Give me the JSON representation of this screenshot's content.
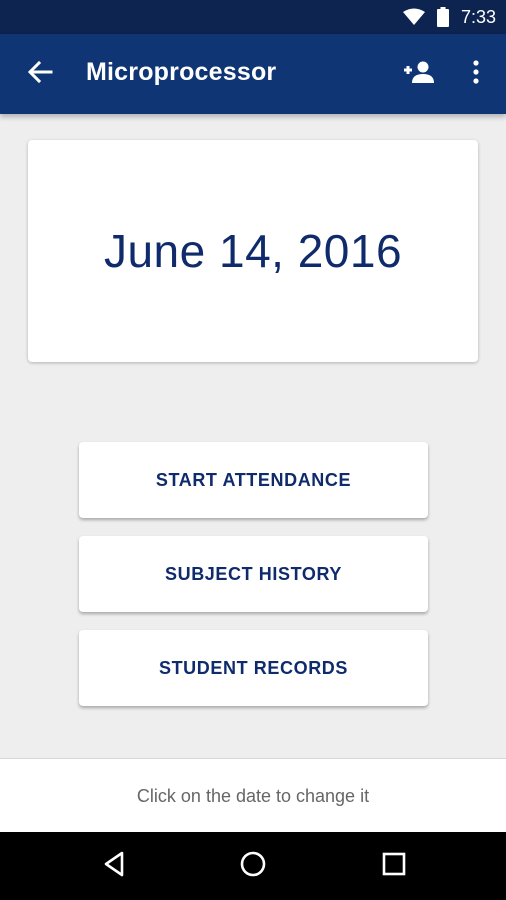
{
  "status_bar": {
    "time": "7:33",
    "icons": [
      "wifi-icon",
      "battery-icon"
    ]
  },
  "app_bar": {
    "title": "Microprocessor",
    "icons": [
      "arrow-back-icon",
      "person-add-icon",
      "more-vert-icon"
    ]
  },
  "date_card": {
    "date": "June 14, 2016"
  },
  "actions": [
    {
      "label": "START ATTENDANCE"
    },
    {
      "label": "SUBJECT HISTORY"
    },
    {
      "label": "STUDENT RECORDS"
    }
  ],
  "hint": {
    "text": "Click on the date to change it"
  },
  "navigation": {
    "icons": [
      "nav-back-icon",
      "nav-home-icon",
      "nav-recents-icon"
    ]
  },
  "colors": {
    "status_bar": "#0d2350",
    "app_bar": "#0f3575",
    "accent_text": "#0f2b6b",
    "background": "#eeeeee"
  }
}
